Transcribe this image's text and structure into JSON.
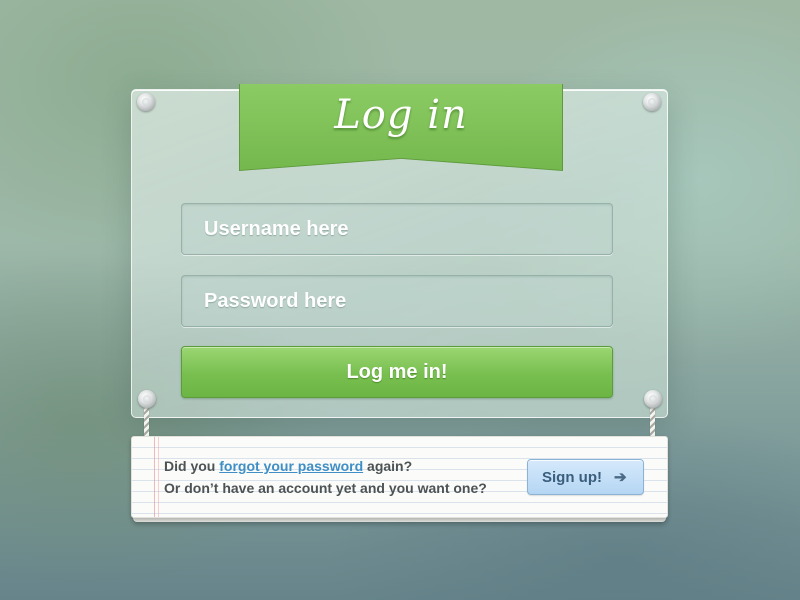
{
  "login": {
    "title": "Log in",
    "username_placeholder": "Username here",
    "password_placeholder": "Password here",
    "submit_label": "Log me in!"
  },
  "note": {
    "line1_prefix": "Did you ",
    "forgot_link": "forgot your password",
    "line1_suffix": " again?",
    "line2": "Or don’t have an account yet and you want one?",
    "signup_label": "Sign up!",
    "signup_icon": "arrow-right-icon"
  },
  "colors": {
    "accent_green": "#78bf4f",
    "link_blue": "#3f8fc6",
    "signup_blue": "#b5d6f3"
  }
}
